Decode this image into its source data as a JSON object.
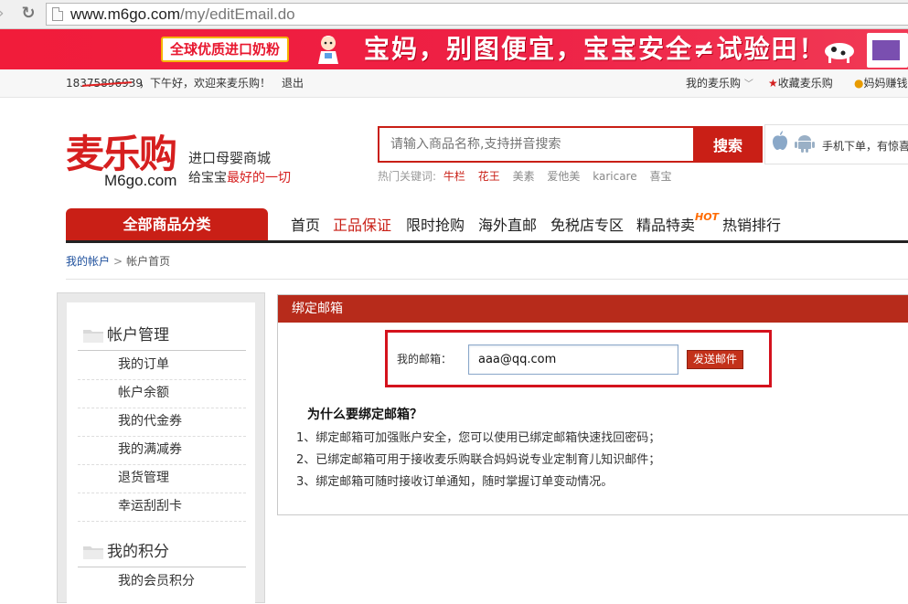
{
  "browser": {
    "url_host": "www.m6go.com",
    "url_path": "/my/editEmail.do"
  },
  "banner": {
    "badge": "全球优质进口奶粉",
    "slogan": "宝妈，别图便宜，宝宝安全≠试验田！"
  },
  "topbar": {
    "phone": "18375896939",
    "greeting": "，下午好，欢迎来麦乐购！",
    "logout": "退出",
    "my_account": "我的麦乐购",
    "favorite": "收藏麦乐购",
    "mama": "妈妈赚钱"
  },
  "header": {
    "logo_main": "麦乐购",
    "logo_domain": "M6go.com",
    "tagline1": "进口母婴商城",
    "tagline2_prefix": "给宝宝",
    "tagline2_highlight": "最好的一切",
    "search_placeholder": "请输入商品名称,支持拼音搜索",
    "search_button": "搜索",
    "hot_label": "热门关键词:",
    "hot_keywords": [
      "牛栏",
      "花王",
      "美素",
      "爱他美",
      "karicare",
      "喜宝"
    ],
    "app_text": "手机下单，有惊喜"
  },
  "nav": {
    "all_categories": "全部商品分类",
    "items": [
      "首页",
      "正品保证",
      "限时抢购",
      "海外直邮",
      "免税店专区",
      "精品特卖",
      "热销排行"
    ],
    "hot_tag": "HOT"
  },
  "breadcrumb": {
    "link": "我的帐户",
    "separator": ">",
    "current": "帐户首页"
  },
  "sidebar": {
    "section1_title": "帐户管理",
    "section1_items": [
      "我的订单",
      "帐户余额",
      "我的代金券",
      "我的满减券",
      "退货管理",
      "幸运刮刮卡"
    ],
    "section2_title": "我的积分",
    "section2_items": [
      "我的会员积分"
    ]
  },
  "panel": {
    "title": "绑定邮箱",
    "email_label": "我的邮箱：",
    "email_value": "aaa@qq.com",
    "send_button": "发送邮件",
    "why_title": "为什么要绑定邮箱？",
    "reasons": [
      "1、绑定邮箱可加强账户安全，您可以使用已绑定邮箱快速找回密码；",
      "2、已绑定邮箱可用于接收麦乐购联合妈妈说专业定制育儿知识邮件；",
      "3、绑定邮箱可随时接收订单通知，随时掌握订单变动情况。"
    ]
  },
  "colors": {
    "brand_red": "#c91f16",
    "panel_header": "#b72b1b",
    "highlight_border": "#d4121d"
  }
}
